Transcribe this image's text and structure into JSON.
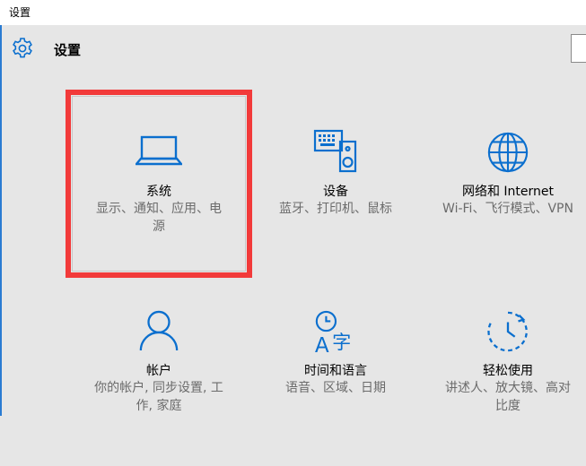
{
  "window": {
    "title": "设置"
  },
  "header": {
    "title": "设置",
    "icon": "gear-icon"
  },
  "accent": "#0b6fce",
  "highlight_color": "#f23a3a",
  "tiles": [
    {
      "label": "系统",
      "desc_line1": "显示、通知、应用、电",
      "desc_line2": "源",
      "icon": "laptop-icon"
    },
    {
      "label": "设备",
      "desc_line1": "蓝牙、打印机、鼠标",
      "desc_line2": "",
      "icon": "devices-icon"
    },
    {
      "label": "网络和 Internet",
      "desc_line1": "Wi-Fi、飞行模式、VPN",
      "desc_line2": "",
      "icon": "globe-icon"
    },
    {
      "label": "帐户",
      "desc_line1": "你的帐户, 同步设置, 工",
      "desc_line2": "作, 家庭",
      "icon": "person-icon"
    },
    {
      "label": "时间和语言",
      "desc_line1": "语音、区域、日期",
      "desc_line2": "",
      "icon": "time-language-icon"
    },
    {
      "label": "轻松使用",
      "desc_line1": "讲述人、放大镜、高对",
      "desc_line2": "比度",
      "icon": "ease-of-access-icon"
    }
  ]
}
